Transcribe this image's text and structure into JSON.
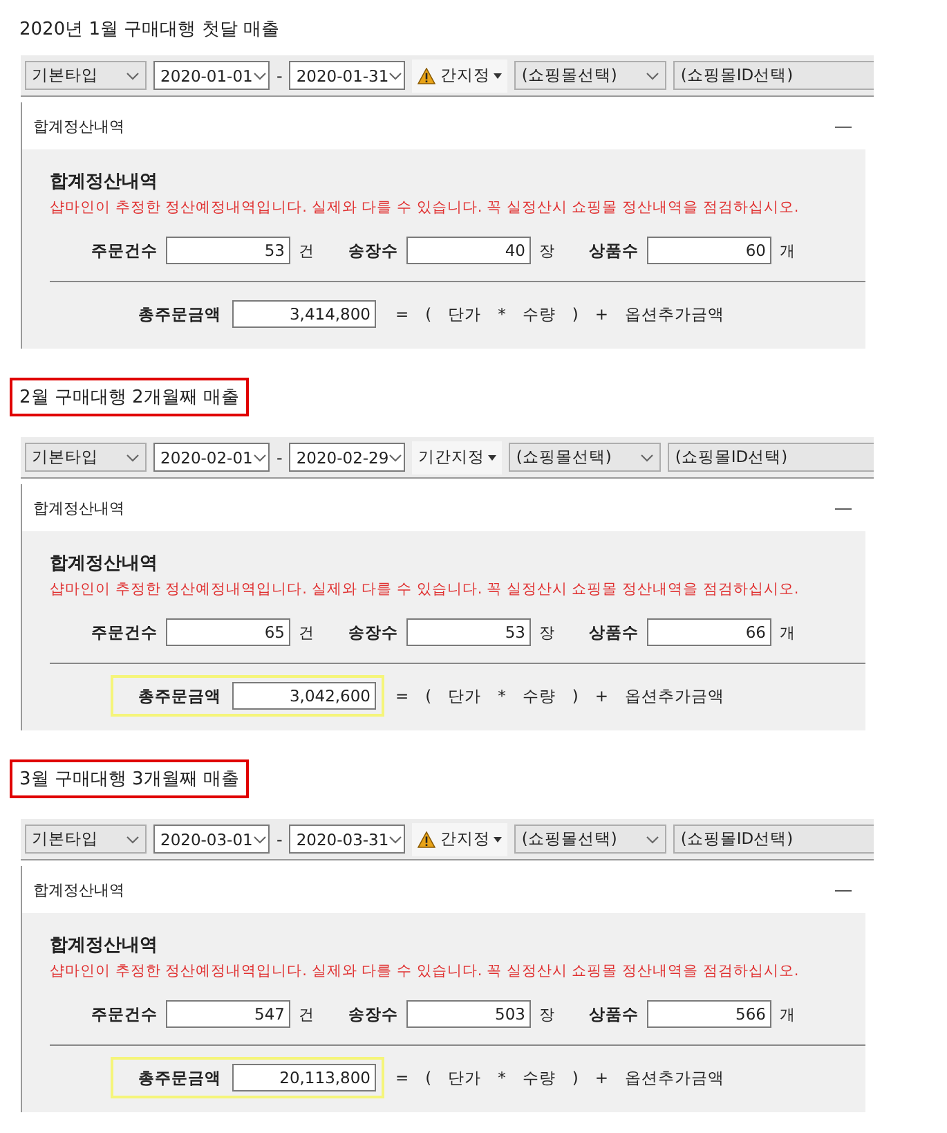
{
  "sections": [
    {
      "heading": "2020년 1월 구매대행 첫달 매출",
      "heading_boxed": false,
      "toolbar": {
        "type": "기본타입",
        "date_from": "2020-01-01",
        "separator": "-",
        "date_to": "2020-01-31",
        "period": "간지정",
        "period_warning": true,
        "mall": "(쇼핑몰선택)",
        "mall_id": "(쇼핑몰ID선택)"
      },
      "panel": {
        "title": "합계정산내역",
        "collapse": "—",
        "heading": "합계정산내역",
        "notice": "샵마인이 추정한 정산예정내역입니다. 실제와 다를 수 있습니다. 꼭 실정산시 쇼핑몰 정산내역을 점검하십시오.",
        "counts": [
          {
            "label": "주문건수",
            "value": "53",
            "unit": "건"
          },
          {
            "label": "송장수",
            "value": "40",
            "unit": "장"
          },
          {
            "label": "상품수",
            "value": "60",
            "unit": "개"
          }
        ],
        "total": {
          "label": "총주문금액",
          "value": "3,414,800",
          "highlighted": false,
          "formula": [
            "=",
            "(",
            "단가",
            "*",
            "수량",
            ")",
            "+",
            "옵션추가금액"
          ]
        }
      }
    },
    {
      "heading": "2월 구매대행 2개월째 매출",
      "heading_boxed": true,
      "toolbar": {
        "type": "기본타입",
        "date_from": "2020-02-01",
        "separator": "-",
        "date_to": "2020-02-29",
        "period": "기간지정",
        "period_warning": false,
        "mall": "(쇼핑몰선택)",
        "mall_id": "(쇼핑몰ID선택)"
      },
      "panel": {
        "title": "합계정산내역",
        "collapse": "—",
        "heading": "합계정산내역",
        "notice": "샵마인이 추정한 정산예정내역입니다. 실제와 다를 수 있습니다. 꼭 실정산시 쇼핑몰 정산내역을 점검하십시오.",
        "counts": [
          {
            "label": "주문건수",
            "value": "65",
            "unit": "건"
          },
          {
            "label": "송장수",
            "value": "53",
            "unit": "장"
          },
          {
            "label": "상품수",
            "value": "66",
            "unit": "개"
          }
        ],
        "total": {
          "label": "총주문금액",
          "value": "3,042,600",
          "highlighted": true,
          "formula": [
            "=",
            "(",
            "단가",
            "*",
            "수량",
            ")",
            "+",
            "옵션추가금액"
          ]
        }
      }
    },
    {
      "heading": "3월 구매대행 3개월째 매출",
      "heading_boxed": true,
      "toolbar": {
        "type": "기본타입",
        "date_from": "2020-03-01",
        "separator": "-",
        "date_to": "2020-03-31",
        "period": "간지정",
        "period_warning": true,
        "mall": "(쇼핑몰선택)",
        "mall_id": "(쇼핑몰ID선택)"
      },
      "panel": {
        "title": "합계정산내역",
        "collapse": "—",
        "heading": "합계정산내역",
        "notice": "샵마인이 추정한 정산예정내역입니다. 실제와 다를 수 있습니다. 꼭 실정산시 쇼핑몰 정산내역을 점검하십시오.",
        "counts": [
          {
            "label": "주문건수",
            "value": "547",
            "unit": "건"
          },
          {
            "label": "송장수",
            "value": "503",
            "unit": "장"
          },
          {
            "label": "상품수",
            "value": "566",
            "unit": "개"
          }
        ],
        "total": {
          "label": "총주문금액",
          "value": "20,113,800",
          "highlighted": true,
          "formula": [
            "=",
            "(",
            "단가",
            "*",
            "수량",
            ")",
            "+",
            "옵션추가금액"
          ]
        }
      }
    }
  ]
}
